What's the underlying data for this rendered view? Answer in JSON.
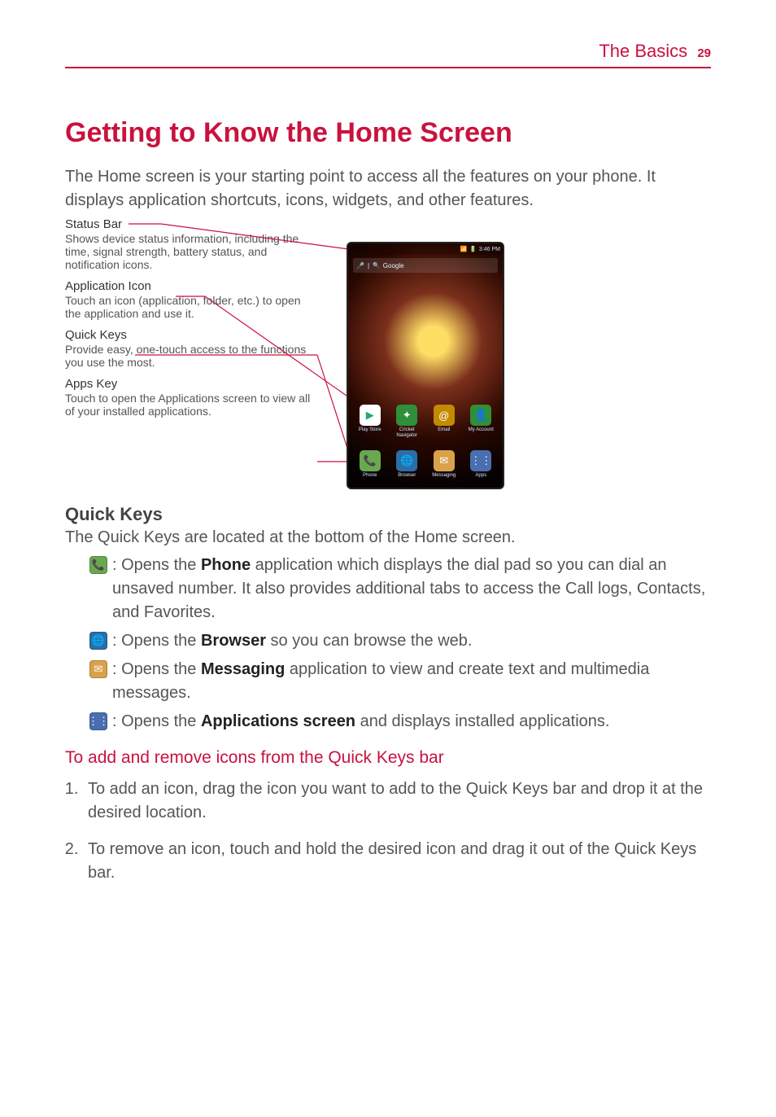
{
  "header": {
    "section": "The Basics",
    "page": "29"
  },
  "title": "Getting to Know the Home Screen",
  "intro": "The Home screen is your starting point to access all the features on your phone. It displays application shortcuts, icons, widgets, and other features.",
  "callouts": [
    {
      "title": "Status Bar",
      "desc": "Shows device status information, including the time, signal strength, battery status, and notification icons."
    },
    {
      "title": "Application Icon",
      "desc": "Touch an icon (application, folder, etc.) to open the application and use it."
    },
    {
      "title": "Quick Keys",
      "desc": "Provide easy, one-touch access to the functions you use the most."
    },
    {
      "title": "Apps Key",
      "desc": "Touch to open the Applications screen to view all of your installed applications."
    }
  ],
  "phone": {
    "status_time": "3:46 PM",
    "search_placeholder": "Google",
    "row1": [
      {
        "label": "Play Store",
        "bg": "#ffffff",
        "glyph": "▶",
        "fg": "#2a7"
      },
      {
        "label": "Cricket Navigator",
        "bg": "#2f8f3a",
        "glyph": "✦"
      },
      {
        "label": "Email",
        "bg": "#c48a00",
        "glyph": "@"
      },
      {
        "label": "My Account",
        "bg": "#2f8f3a",
        "glyph": "👤"
      }
    ],
    "row2": [
      {
        "label": "Phone",
        "bg": "#6aa84f",
        "glyph": "📞"
      },
      {
        "label": "Browser",
        "bg": "#2b6ea8",
        "glyph": "🌐"
      },
      {
        "label": "Messaging",
        "bg": "#d9a24a",
        "glyph": "✉"
      },
      {
        "label": "Apps",
        "bg": "#4a6fb0",
        "glyph": "⋮⋮"
      }
    ]
  },
  "quick_keys": {
    "heading": "Quick Keys",
    "intro": "The Quick Keys are located at the bottom of the Home screen.",
    "items": [
      {
        "icon_bg": "#6aa84f",
        "icon_glyph": "📞",
        "pre": ": Opens the ",
        "bold": "Phone",
        "post": " application which displays the dial pad so you can dial an unsaved number. It also provides additional tabs to access the Call logs, Contacts, and Favorites."
      },
      {
        "icon_bg": "#2b6ea8",
        "icon_glyph": "🌐",
        "pre": ": Opens the ",
        "bold": "Browser",
        "post": " so you can browse the web."
      },
      {
        "icon_bg": "#d9a24a",
        "icon_glyph": "✉",
        "pre": ": Opens the ",
        "bold": "Messaging",
        "post": " application to view and create text and multimedia messages."
      },
      {
        "icon_bg": "#4a6fb0",
        "icon_glyph": "⋮⋮",
        "pre": ": Opens the ",
        "bold": "Applications screen",
        "post": " and displays installed applications."
      }
    ]
  },
  "add_remove": {
    "heading": "To add and remove icons from the Quick Keys bar",
    "steps": [
      "To add an icon, drag the icon you want to add to the Quick Keys bar and drop it at the desired location.",
      "To remove an icon, touch and hold the desired icon and drag it out of the Quick Keys bar."
    ]
  }
}
